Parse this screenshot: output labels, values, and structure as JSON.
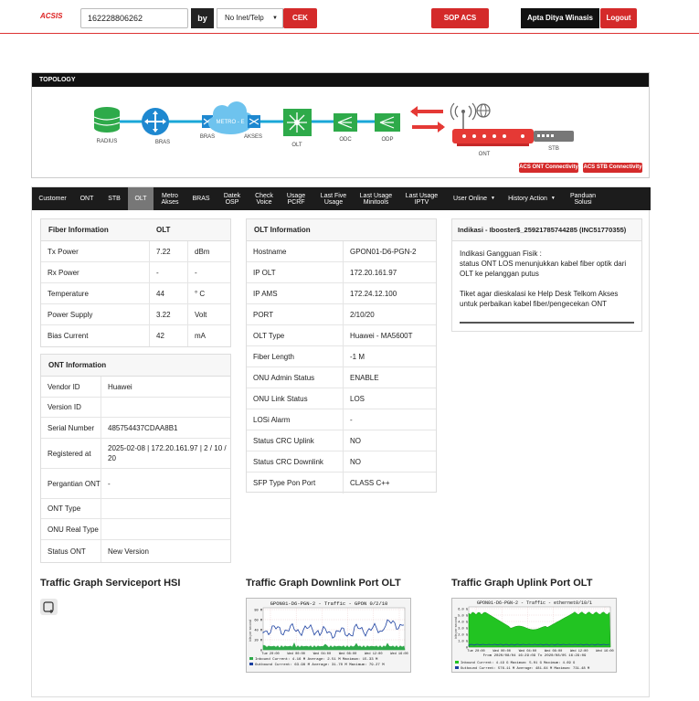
{
  "header": {
    "brand": "ACSIS",
    "search_value": "162228806262",
    "by_label": "by",
    "select_value": "No Inet/Telp",
    "cek_label": "CEK",
    "sop_label": "SOP ACS",
    "user_name": "Apta Ditya Winasis",
    "logout_label": "Logout"
  },
  "topology": {
    "title": "TOPOLOGY",
    "nodes": {
      "radius": "RADIUS",
      "bras": "BRAS",
      "bras2": "BRAS",
      "metro": "METRO - E",
      "akses": "AKSES",
      "olt": "OLT",
      "odc": "ODC",
      "odp": "ODP",
      "ont": "ONT",
      "stb": "STB"
    },
    "acs_ont": "ACS ONT Connectivity",
    "acs_stb": "ACS STB Connectivity"
  },
  "nav": {
    "customer": "Customer",
    "ont": "ONT",
    "stb": "STB",
    "olt": "OLT",
    "metro_1": "Metro",
    "metro_2": "Akses",
    "bras": "BRAS",
    "datek_1": "Datek",
    "datek_2": "OSP",
    "check_1": "Check",
    "check_2": "Voice",
    "usage_1": "Usage",
    "usage_2": "PCRF",
    "lfu_1": "Last Five",
    "lfu_2": "Usage",
    "lum_1": "Last Usage",
    "lum_2": "Minitools",
    "lui_1": "Last Usage",
    "lui_2": "IPTV",
    "user_online": "User Online",
    "history": "History Action",
    "panduan_1": "Panduan",
    "panduan_2": "Solusi"
  },
  "fiber": {
    "head_label": "Fiber Information",
    "head_value": "OLT",
    "rows": [
      {
        "label": "Tx Power",
        "value": "7.22",
        "unit": "dBm"
      },
      {
        "label": "Rx Power",
        "value": "-",
        "unit": "-"
      },
      {
        "label": "Temperature",
        "value": "44",
        "unit": "° C"
      },
      {
        "label": "Power Supply",
        "value": "3.22",
        "unit": "Volt"
      },
      {
        "label": "Bias Current",
        "value": "42",
        "unit": "mA"
      }
    ]
  },
  "ont_info": {
    "title": "ONT Information",
    "rows": [
      {
        "label": "Vendor ID",
        "value": "Huawei"
      },
      {
        "label": "Version ID",
        "value": ""
      },
      {
        "label": "Serial Number",
        "value": "485754437CDAA8B1"
      },
      {
        "label": "Registered at",
        "value": "2025-02-08 | 172.20.161.97 | 2 / 10 / 20"
      },
      {
        "label": "Pergantian ONT",
        "value": "-"
      },
      {
        "label": "ONT Type",
        "value": ""
      },
      {
        "label": "ONU Real Type",
        "value": ""
      },
      {
        "label": "Status ONT",
        "value": "New Version"
      }
    ]
  },
  "olt_info": {
    "title": "OLT Information",
    "rows": [
      {
        "label": "Hostname",
        "value": "GPON01-D6-PGN-2"
      },
      {
        "label": "IP OLT",
        "value": "172.20.161.97"
      },
      {
        "label": "IP AMS",
        "value": "172.24.12.100"
      },
      {
        "label": "PORT",
        "value": "2/10/20"
      },
      {
        "label": "OLT Type",
        "value": "Huawei - MA5600T"
      },
      {
        "label": "Fiber Length",
        "value": "-1 M"
      },
      {
        "label": "ONU Admin Status",
        "value": "ENABLE"
      },
      {
        "label": "ONU Link Status",
        "value": "LOS"
      },
      {
        "label": "LOSi Alarm",
        "value": "-"
      },
      {
        "label": "Status CRC Uplink",
        "value": "NO"
      },
      {
        "label": "Status CRC Downlink",
        "value": "NO"
      },
      {
        "label": "SFP Type Pon Port",
        "value": "CLASS C++"
      }
    ]
  },
  "indikasi": {
    "title": "Indikasi - Ibooster$_25921785744285 (INC51770355)",
    "line1": "Indikasi Gangguan Fisik :",
    "line2": "status ONT LOS menunjukkan kabel fiber optik dari OLT ke pelanggan putus",
    "line3": "Tiket agar dieskalasi ke Help Desk Telkom Akses untuk perbaikan kabel fiber/pengecekan ONT"
  },
  "traffic": {
    "hsi_title": "Traffic Graph Serviceport HSI",
    "down_title": "Traffic Graph Downlink Port OLT",
    "up_title": "Traffic Graph Uplink Port OLT",
    "down_graph": {
      "title": "GPON01-D6-PGN-2 - Traffic - GPON 0/2/10",
      "inbound": "Inbound   Current:    4.16 M   Average:    2.51 M   Maximum:   15.33 M",
      "outbound": "Outbound  Current:   63.98 M   Average:   31.70 M   Maximum:   79.27 M",
      "xlabels": [
        "Tue 20:00",
        "Wed 00:00",
        "Wed 04:00",
        "Wed 08:00",
        "Wed 12:00",
        "Wed 16:00"
      ],
      "ylabels": [
        "80 M",
        "60 M",
        "40 M",
        "20 M",
        "0"
      ]
    },
    "up_graph": {
      "title": "GPON01-D6-PGN-2 - Traffic - ethernet0/10/1",
      "period": "From 2020/08/04 16:29:09 To 2020/08/05 16:29:09",
      "inbound": "Inbound   Current:   4.19 G   Maximum:   5.01 G   Maximum:   4.69 G",
      "outbound": "Outbound  Current:  576.11 M   Average:  481.64 M   Maximum:  731.48 M",
      "xlabels": [
        "Tue 20:00",
        "Wed 00:00",
        "Wed 04:00",
        "Wed 08:00",
        "Wed 12:00",
        "Wed 16:00"
      ],
      "ylabels": [
        "6.0 G",
        "5.0 G",
        "4.0 G",
        "3.0 G",
        "2.0 G",
        "1.0 G",
        "0"
      ]
    }
  }
}
